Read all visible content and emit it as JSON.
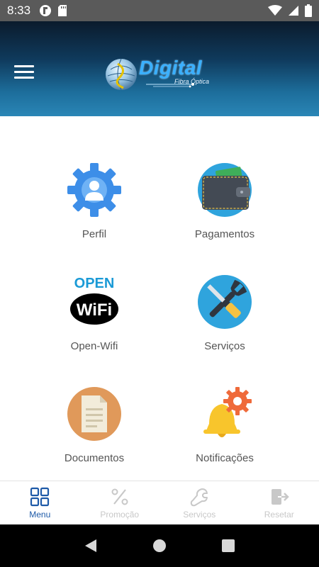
{
  "status_bar": {
    "time": "8:33",
    "icons": [
      "app-notification-icon",
      "sd-card-icon",
      "wifi-icon",
      "signal-icon",
      "battery-icon"
    ]
  },
  "header": {
    "menu_icon": "hamburger-menu-icon",
    "logo_text": "Digital",
    "logo_subtitle": "Fibra Óptica"
  },
  "menu": {
    "items": [
      {
        "label": "Perfil",
        "icon": "profile-gear-icon"
      },
      {
        "label": "Pagamentos",
        "icon": "wallet-icon"
      },
      {
        "label": "Open-Wifi",
        "icon": "open-wifi-icon",
        "icon_text_top": "OPEN",
        "icon_text_bottom": "WiFi"
      },
      {
        "label": "Serviços",
        "icon": "tools-icon"
      },
      {
        "label": "Documentos",
        "icon": "document-icon"
      },
      {
        "label": "Notificações",
        "icon": "bell-gear-icon"
      }
    ]
  },
  "bottom_nav": {
    "items": [
      {
        "label": "Menu",
        "icon": "grid-icon",
        "active": true
      },
      {
        "label": "Promoção",
        "icon": "percent-icon",
        "active": false
      },
      {
        "label": "Serviços",
        "icon": "wrench-icon",
        "active": false
      },
      {
        "label": "Resetar",
        "icon": "exit-icon",
        "active": false
      }
    ]
  },
  "colors": {
    "active": "#1e5aa8",
    "inactive": "#c8c8c8",
    "header_dark": "#0b1b2c",
    "header_light": "#2a86b6"
  }
}
